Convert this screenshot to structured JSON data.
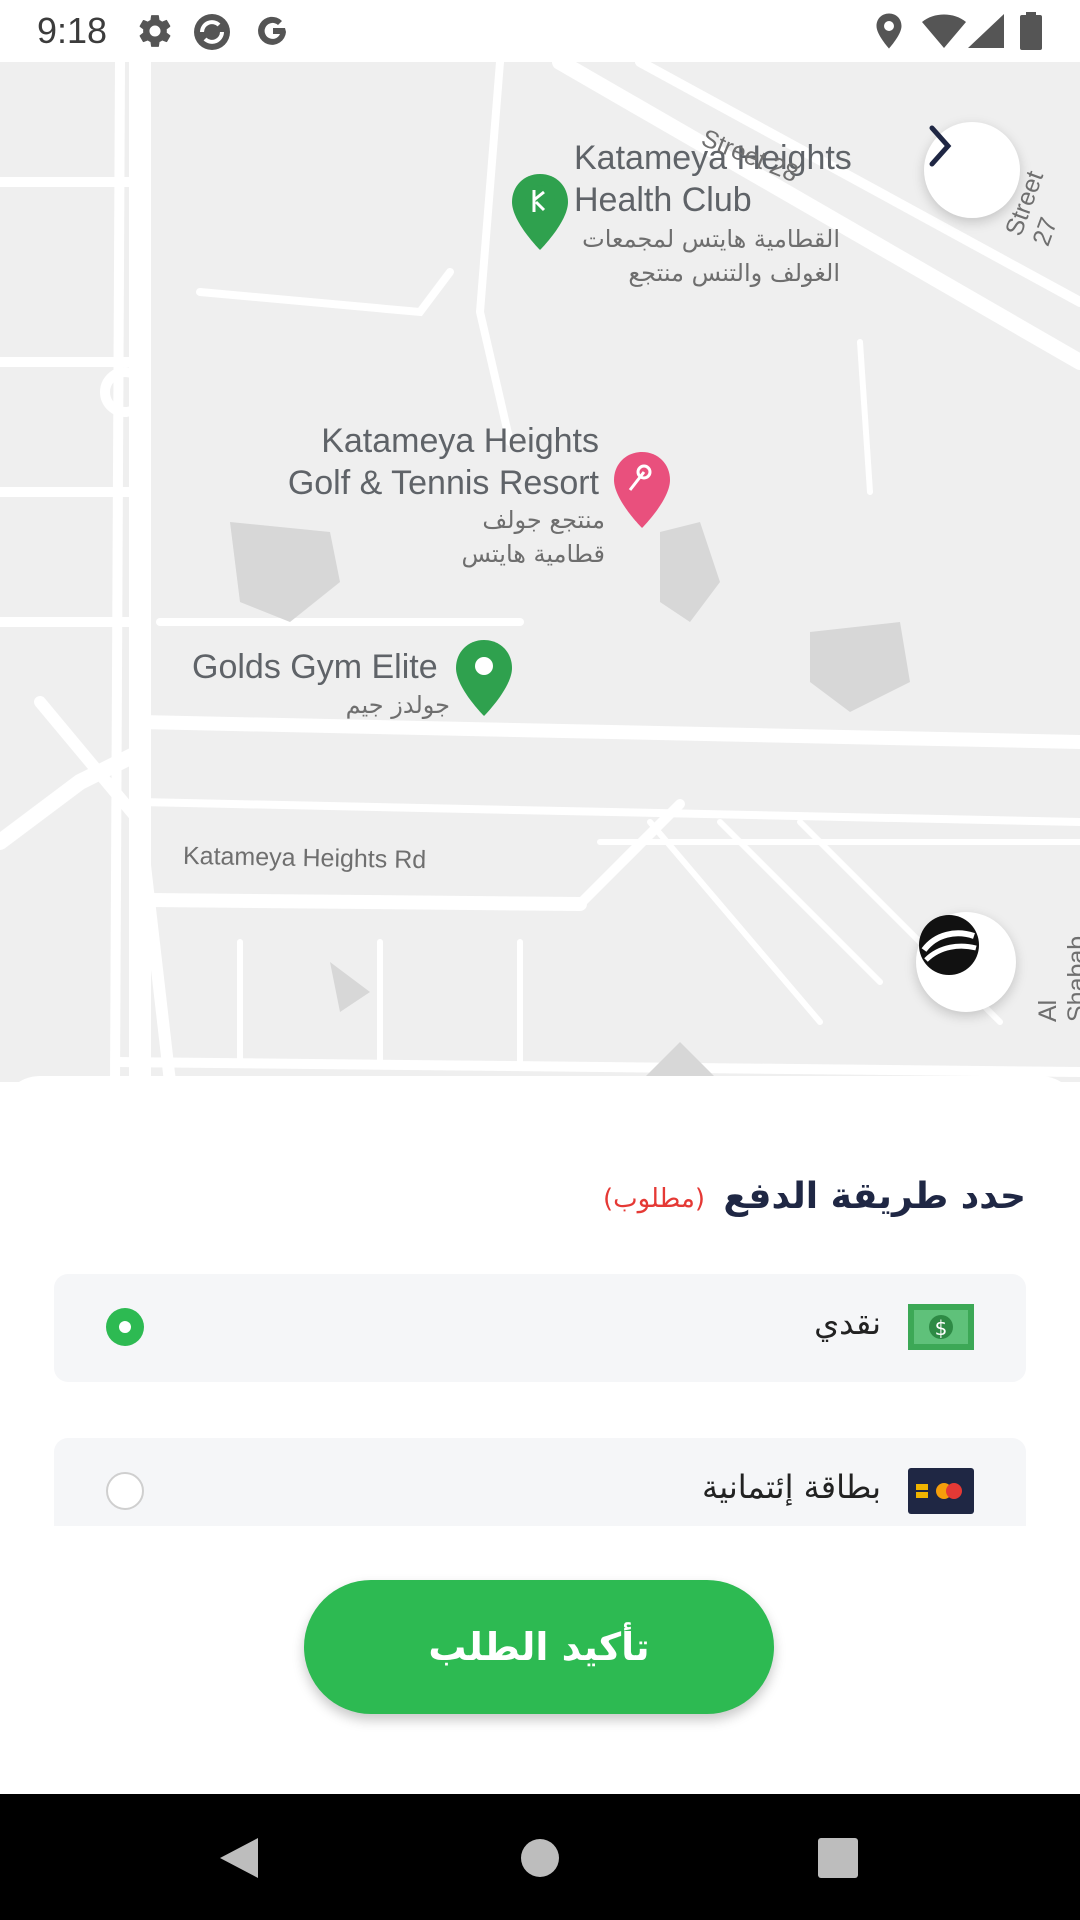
{
  "status_bar": {
    "time": "9:18",
    "icons": [
      "gear-icon",
      "sync-icon",
      "google-icon",
      "location-icon",
      "wifi-icon",
      "signal-icon",
      "battery-icon"
    ]
  },
  "map": {
    "pois": [
      {
        "name_line1": "Katameya Heights",
        "name_line2": "Health Club",
        "name_ar": "القطامية هايتس لمجمعات الغولف والتنس منتجع"
      },
      {
        "name_line1": "Katameya Heights",
        "name_line2": "Golf & Tennis Resort",
        "name_ar": "منتجع جولف قطامية هايتس"
      },
      {
        "name_line1": "Golds Gym Elite",
        "name_ar": "جولدز جيم"
      }
    ],
    "roads": {
      "street28": "Street 28",
      "street27": "Street 27",
      "katameya_rd": "Katameya Heights Rd",
      "al_shabab": "Al Shabab"
    },
    "colors": {
      "green_pin": "#2fa14e",
      "pink_pin": "#e9507d"
    }
  },
  "payment": {
    "title": "حدد طريقة الدفع",
    "required": "(مطلوب)",
    "options": [
      {
        "label": "نقدي",
        "selected": true,
        "icon": "cash-icon"
      },
      {
        "label": "بطاقة إئتمانية",
        "selected": false,
        "icon": "credit-card-icon"
      }
    ]
  },
  "confirm_button": "تأكيد الطلب",
  "colors": {
    "accent": "#2dba52",
    "title": "#1f2744",
    "required": "#e53935"
  }
}
